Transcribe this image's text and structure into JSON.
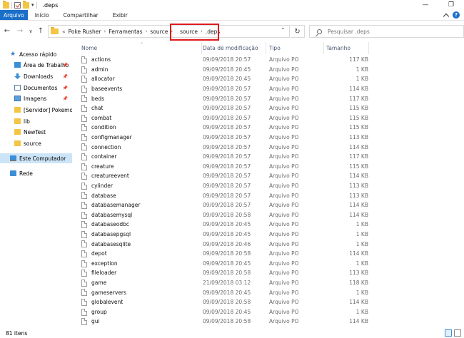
{
  "window": {
    "title": ".deps",
    "minimize": "—",
    "maximize": "❐"
  },
  "ribbon": {
    "tabs": [
      "Arquivo",
      "Início",
      "Compartilhar",
      "Exibir"
    ]
  },
  "address": {
    "overflow": "«",
    "crumbs": [
      "Poke Rusher",
      "Ferramentas",
      "source",
      "source",
      ".deps"
    ],
    "search_placeholder": "Pesquisar .deps"
  },
  "sidebar": {
    "items": [
      {
        "label": "Acesso rápido",
        "icon": "star-icon",
        "pinned": false
      },
      {
        "label": "Área de Trabalho",
        "icon": "desktop-icon",
        "pinned": true
      },
      {
        "label": "Downloads",
        "icon": "downloads-icon",
        "pinned": true
      },
      {
        "label": "Documentos",
        "icon": "documents-icon",
        "pinned": true
      },
      {
        "label": "Imagens",
        "icon": "images-icon",
        "pinned": true
      },
      {
        "label": "[Servidor] Pokemon",
        "icon": "folder-icon",
        "pinned": false
      },
      {
        "label": "lib",
        "icon": "folder-icon",
        "pinned": false
      },
      {
        "label": "NewTest",
        "icon": "folder-icon",
        "pinned": false
      },
      {
        "label": "source",
        "icon": "folder-icon",
        "pinned": false
      },
      {
        "label": "Este Computador",
        "icon": "computer-icon",
        "pinned": false,
        "selected": true
      },
      {
        "label": "Rede",
        "icon": "network-icon",
        "pinned": false
      }
    ]
  },
  "columns": {
    "name": "Nome",
    "date": "Data de modificação",
    "type": "Tipo",
    "size": "Tamanho"
  },
  "files": [
    {
      "name": "actions",
      "date": "09/09/2018 20:57",
      "type": "Arquivo PO",
      "size": "117 KB"
    },
    {
      "name": "admin",
      "date": "09/09/2018 20:45",
      "type": "Arquivo PO",
      "size": "1 KB"
    },
    {
      "name": "allocator",
      "date": "09/09/2018 20:45",
      "type": "Arquivo PO",
      "size": "1 KB"
    },
    {
      "name": "baseevents",
      "date": "09/09/2018 20:57",
      "type": "Arquivo PO",
      "size": "114 KB"
    },
    {
      "name": "beds",
      "date": "09/09/2018 20:57",
      "type": "Arquivo PO",
      "size": "117 KB"
    },
    {
      "name": "chat",
      "date": "09/09/2018 20:57",
      "type": "Arquivo PO",
      "size": "115 KB"
    },
    {
      "name": "combat",
      "date": "09/09/2018 20:57",
      "type": "Arquivo PO",
      "size": "115 KB"
    },
    {
      "name": "condition",
      "date": "09/09/2018 20:57",
      "type": "Arquivo PO",
      "size": "115 KB"
    },
    {
      "name": "configmanager",
      "date": "09/09/2018 20:57",
      "type": "Arquivo PO",
      "size": "113 KB"
    },
    {
      "name": "connection",
      "date": "09/09/2018 20:57",
      "type": "Arquivo PO",
      "size": "114 KB"
    },
    {
      "name": "container",
      "date": "09/09/2018 20:57",
      "type": "Arquivo PO",
      "size": "117 KB"
    },
    {
      "name": "creature",
      "date": "09/09/2018 20:57",
      "type": "Arquivo PO",
      "size": "115 KB"
    },
    {
      "name": "creatureevent",
      "date": "09/09/2018 20:57",
      "type": "Arquivo PO",
      "size": "114 KB"
    },
    {
      "name": "cylinder",
      "date": "09/09/2018 20:57",
      "type": "Arquivo PO",
      "size": "113 KB"
    },
    {
      "name": "database",
      "date": "09/09/2018 20:57",
      "type": "Arquivo PO",
      "size": "113 KB"
    },
    {
      "name": "databasemanager",
      "date": "09/09/2018 20:57",
      "type": "Arquivo PO",
      "size": "114 KB"
    },
    {
      "name": "databasemysql",
      "date": "09/09/2018 20:58",
      "type": "Arquivo PO",
      "size": "114 KB"
    },
    {
      "name": "databaseodbc",
      "date": "09/09/2018 20:45",
      "type": "Arquivo PO",
      "size": "1 KB"
    },
    {
      "name": "databasepgsql",
      "date": "09/09/2018 20:45",
      "type": "Arquivo PO",
      "size": "1 KB"
    },
    {
      "name": "databasesqlite",
      "date": "09/09/2018 20:46",
      "type": "Arquivo PO",
      "size": "1 KB"
    },
    {
      "name": "depot",
      "date": "09/09/2018 20:58",
      "type": "Arquivo PO",
      "size": "114 KB"
    },
    {
      "name": "exception",
      "date": "09/09/2018 20:45",
      "type": "Arquivo PO",
      "size": "1 KB"
    },
    {
      "name": "fileloader",
      "date": "09/09/2018 20:58",
      "type": "Arquivo PO",
      "size": "113 KB"
    },
    {
      "name": "game",
      "date": "21/09/2018 03:12",
      "type": "Arquivo PO",
      "size": "118 KB"
    },
    {
      "name": "gameservers",
      "date": "09/09/2018 20:45",
      "type": "Arquivo PO",
      "size": "1 KB"
    },
    {
      "name": "globalevent",
      "date": "09/09/2018 20:58",
      "type": "Arquivo PO",
      "size": "114 KB"
    },
    {
      "name": "group",
      "date": "09/09/2018 20:45",
      "type": "Arquivo PO",
      "size": "1 KB"
    },
    {
      "name": "gui",
      "date": "09/09/2018 20:58",
      "type": "Arquivo PO",
      "size": "114 KB"
    }
  ],
  "status": {
    "count": "81 itens"
  }
}
